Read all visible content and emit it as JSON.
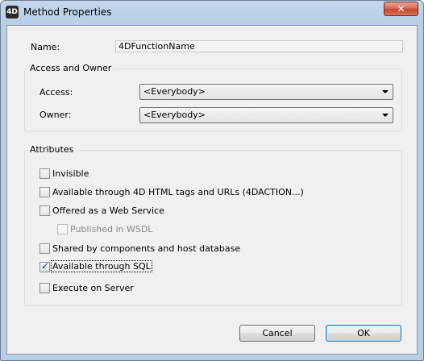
{
  "window": {
    "title": "Method Properties",
    "app_icon_text": "4D",
    "close_glyph": "✕"
  },
  "name": {
    "label": "Name:",
    "value": "4DFunctionName"
  },
  "access_owner": {
    "title": "Access and Owner",
    "access_label": "Access:",
    "access_value": "<Everybody>",
    "owner_label": "Owner:",
    "owner_value": "<Everybody>"
  },
  "attributes": {
    "title": "Attributes",
    "items": [
      {
        "label": "Invisible",
        "checked": false,
        "enabled": true
      },
      {
        "label": "Available through 4D HTML tags and URLs (4DACTION...)",
        "checked": false,
        "enabled": true
      },
      {
        "label": "Offered as a Web Service",
        "checked": false,
        "enabled": true
      },
      {
        "label": "Published in WSDL",
        "checked": false,
        "enabled": false
      },
      {
        "label": "Shared by components and host database",
        "checked": false,
        "enabled": true
      },
      {
        "label": "Available through SQL",
        "checked": true,
        "enabled": true
      },
      {
        "label": "Execute on Server",
        "checked": false,
        "enabled": true
      }
    ]
  },
  "buttons": {
    "cancel": "Cancel",
    "ok": "OK"
  },
  "icons": {
    "app": "4d-app-icon",
    "close": "close-icon",
    "dropdown": "chevron-down-icon",
    "check": "checkmark-icon"
  },
  "colors": {
    "title_bar": "#b9cfe7",
    "client_bg": "#f0f0f0",
    "close_button": "#c44a2c",
    "default_button_border": "#3c7fb1"
  }
}
